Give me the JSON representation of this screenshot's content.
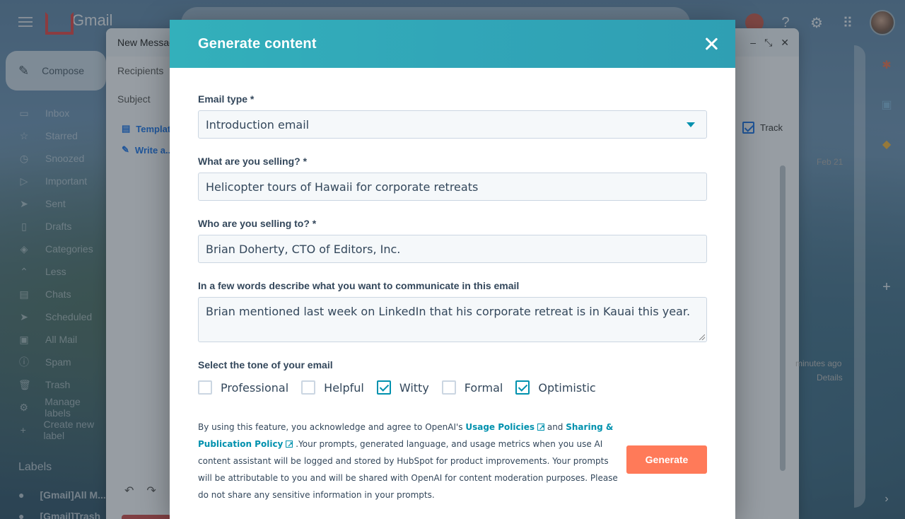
{
  "gmail": {
    "logo_text": "Gmail",
    "compose_label": "Compose",
    "nav": [
      {
        "label": "Inbox",
        "icon": "inbox-icon",
        "glyph": "▭"
      },
      {
        "label": "Starred",
        "icon": "star-icon",
        "glyph": "☆"
      },
      {
        "label": "Snoozed",
        "icon": "clock-icon",
        "glyph": "◷"
      },
      {
        "label": "Important",
        "icon": "important-icon",
        "glyph": "▷"
      },
      {
        "label": "Sent",
        "icon": "send-icon",
        "glyph": "➤"
      },
      {
        "label": "Drafts",
        "icon": "draft-icon",
        "glyph": "▯"
      },
      {
        "label": "Categories",
        "icon": "label-icon",
        "glyph": "◈"
      },
      {
        "label": "Less",
        "icon": "chevron-up-icon",
        "glyph": "⌃"
      },
      {
        "label": "Chats",
        "icon": "chat-icon",
        "glyph": "▤"
      },
      {
        "label": "Scheduled",
        "icon": "scheduled-icon",
        "glyph": "➤"
      },
      {
        "label": "All Mail",
        "icon": "all-mail-icon",
        "glyph": "▣"
      },
      {
        "label": "Spam",
        "icon": "spam-icon",
        "glyph": "ⓘ"
      },
      {
        "label": "Trash",
        "icon": "trash-icon",
        "glyph": "🗑"
      },
      {
        "label": "Manage labels",
        "icon": "gear-icon",
        "glyph": "⚙"
      },
      {
        "label": "Create new label",
        "icon": "plus-icon",
        "glyph": "+"
      }
    ],
    "labels_heading": "Labels",
    "labels": [
      {
        "label": "[Gmail]All M..."
      },
      {
        "label": "[Gmail]Trash"
      }
    ],
    "compose_window": {
      "title": "New Message",
      "recipients_label": "Recipients",
      "subject_label": "Subject",
      "templates_label": "Templates",
      "write_label": "Write a...",
      "track_label": "Track",
      "date_label": "Feb 21",
      "time_ago": "minutes ago",
      "details_label": "Details"
    }
  },
  "modal": {
    "title": "Generate content",
    "email_type": {
      "label": "Email type *",
      "value": "Introduction email"
    },
    "selling_what": {
      "label": "What are you selling? *",
      "value": "Helicopter tours of Hawaii for corporate retreats"
    },
    "selling_to": {
      "label": "Who are you selling to? *",
      "value": "Brian Doherty, CTO of Editors, Inc."
    },
    "describe": {
      "label": "In a few words describe what you want to communicate in this email",
      "value": "Brian mentioned last week on LinkedIn that his corporate retreat is in Kauai this year."
    },
    "tone": {
      "label": "Select the tone of your email",
      "options": [
        {
          "label": "Professional",
          "checked": false
        },
        {
          "label": "Helpful",
          "checked": false
        },
        {
          "label": "Witty",
          "checked": true
        },
        {
          "label": "Formal",
          "checked": false
        },
        {
          "label": "Optimistic",
          "checked": true
        }
      ]
    },
    "disclaimer": {
      "part1": "By using this feature, you acknowledge and agree to OpenAI's ",
      "link1": "Usage Policies",
      "part2": " and ",
      "link2": "Sharing & Publication Policy",
      "part3": " .Your prompts, generated language, and usage metrics when you use AI content assistant will be logged and stored by HubSpot for product improvements. Your prompts will be attributable to you and will be shared with OpenAI for content moderation purposes. Please do not share any sensitive information in your prompts."
    },
    "generate_label": "Generate",
    "colors": {
      "header": "#33b0bb",
      "accent": "#0091ae",
      "button": "#ff7a59",
      "text": "#33475b"
    }
  }
}
